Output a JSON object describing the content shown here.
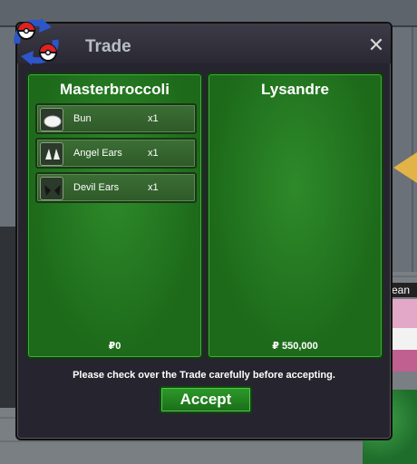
{
  "window": {
    "title": "Trade",
    "close_icon": "close-icon",
    "logo_icon": "trade-swap-icon"
  },
  "left_panel": {
    "player_name": "Masterbroccoli",
    "money": "₽0",
    "items": [
      {
        "name": "Bun",
        "qty": "x1",
        "icon": "bun-icon"
      },
      {
        "name": "Angel Ears",
        "qty": "x1",
        "icon": "angel-ears-icon"
      },
      {
        "name": "Devil Ears",
        "qty": "x1",
        "icon": "devil-ears-icon"
      }
    ]
  },
  "right_panel": {
    "player_name": "Lysandre",
    "money": "₽ 550,000",
    "items": []
  },
  "notice": "Please check over the Trade carefully before accepting.",
  "accept_label": "Accept",
  "background": {
    "npc_label": "ean"
  },
  "colors": {
    "panel_green": "#2e8a2a",
    "window_dark": "#26242e",
    "accept_green": "#2d9a2a"
  }
}
